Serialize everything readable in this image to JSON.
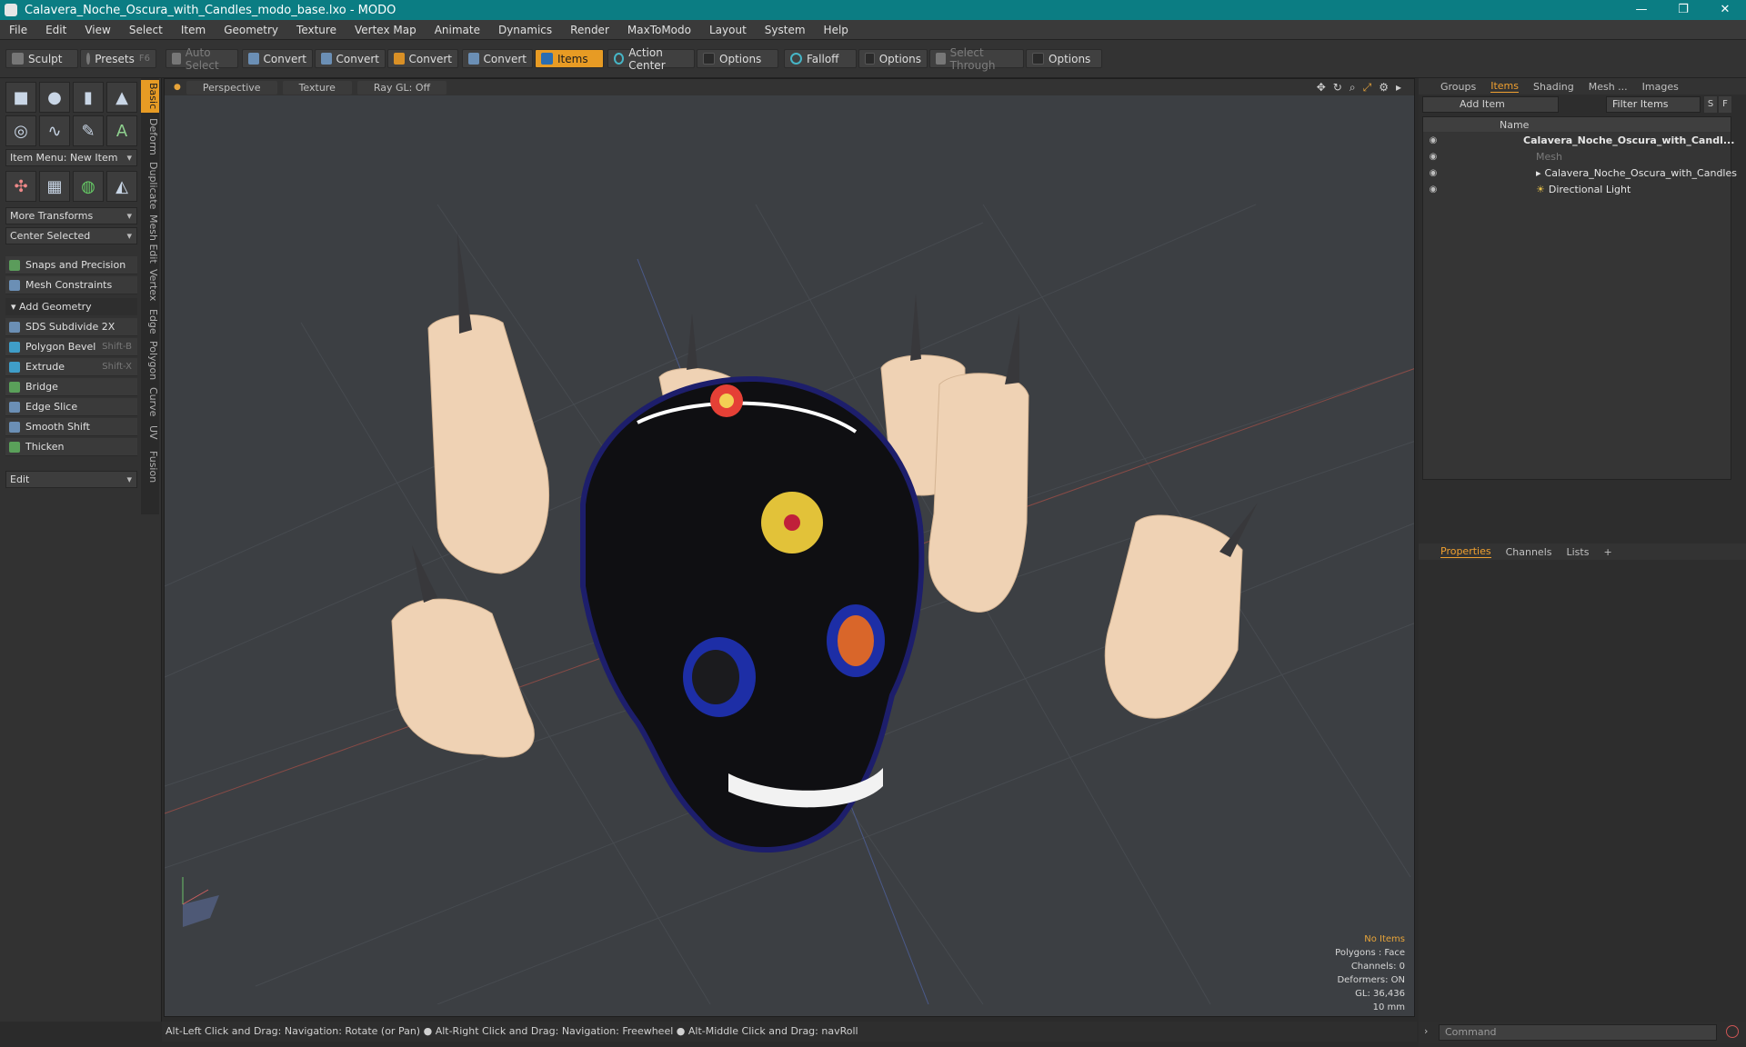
{
  "window": {
    "title": "Calavera_Noche_Oscura_with_Candles_modo_base.lxo - MODO",
    "min": "—",
    "max": "❐",
    "close": "✕"
  },
  "menu": [
    "File",
    "Edit",
    "View",
    "Select",
    "Item",
    "Geometry",
    "Texture",
    "Vertex Map",
    "Animate",
    "Dynamics",
    "Render",
    "MaxToModo",
    "Layout",
    "System",
    "Help"
  ],
  "toolbar": {
    "sculpt": "Sculpt",
    "presets": "Presets",
    "presets_key": "F6",
    "auto_select": "Auto Select",
    "convert1": "Convert",
    "convert2": "Convert",
    "convert3": "Convert",
    "convert4": "Convert",
    "items": "Items",
    "action_center": "Action Center",
    "options1": "Options",
    "falloff": "Falloff",
    "options2": "Options",
    "select_through": "Select Through",
    "options3": "Options"
  },
  "left": {
    "vtabs": [
      "Basic",
      "Deform",
      "Duplicate",
      "Mesh Edit",
      "Vertex",
      "Edge",
      "Polygon",
      "Curve",
      "UV",
      "Fusion"
    ],
    "item_menu": "Item Menu: New Item",
    "more_transforms": "More Transforms",
    "center_selected": "Center Selected",
    "snaps": "Snaps and Precision",
    "mesh_constraints": "Mesh Constraints",
    "add_geometry": "Add Geometry",
    "tools": [
      {
        "label": "SDS Subdivide 2X",
        "key": ""
      },
      {
        "label": "Polygon Bevel",
        "key": "Shift-B"
      },
      {
        "label": "Extrude",
        "key": "Shift-X"
      },
      {
        "label": "Bridge",
        "key": ""
      },
      {
        "label": "Edge Slice",
        "key": ""
      },
      {
        "label": "Smooth Shift",
        "key": ""
      },
      {
        "label": "Thicken",
        "key": ""
      }
    ],
    "edit": "Edit"
  },
  "viewport": {
    "tabs": [
      "Perspective",
      "Texture",
      "Ray GL: Off"
    ],
    "info": {
      "no_items": "No Items",
      "polygons": "Polygons : Face",
      "channels": "Channels: 0",
      "deformers": "Deformers: ON",
      "gl": "GL: 36,436",
      "scale": "10 mm"
    }
  },
  "right": {
    "tabs": [
      "Groups",
      "Items",
      "Shading",
      "Mesh ...",
      "Images"
    ],
    "add_item": "Add Item",
    "filter_items": "Filter Items",
    "filter_s": "S",
    "filter_f": "F",
    "col_name": "Name",
    "items": [
      {
        "name": "Calavera_Noche_Oscura_with_Candl..."
      },
      {
        "name": "Mesh"
      },
      {
        "name": "Calavera_Noche_Oscura_with_Candles"
      },
      {
        "name": "Directional Light"
      }
    ],
    "bottom_tabs": [
      "Properties",
      "Channels",
      "Lists"
    ],
    "command_placeholder": "Command"
  },
  "status": {
    "hint": "Alt-Left Click and Drag: Navigation: Rotate (or Pan) ● Alt-Right Click and Drag: Navigation: Freewheel ● Alt-Middle Click and Drag: navRoll"
  },
  "colors": {
    "titlebar": "#0b7d83",
    "accent": "#e79b24",
    "candle": "#e9c9a8",
    "skull": "#0f0f12"
  }
}
